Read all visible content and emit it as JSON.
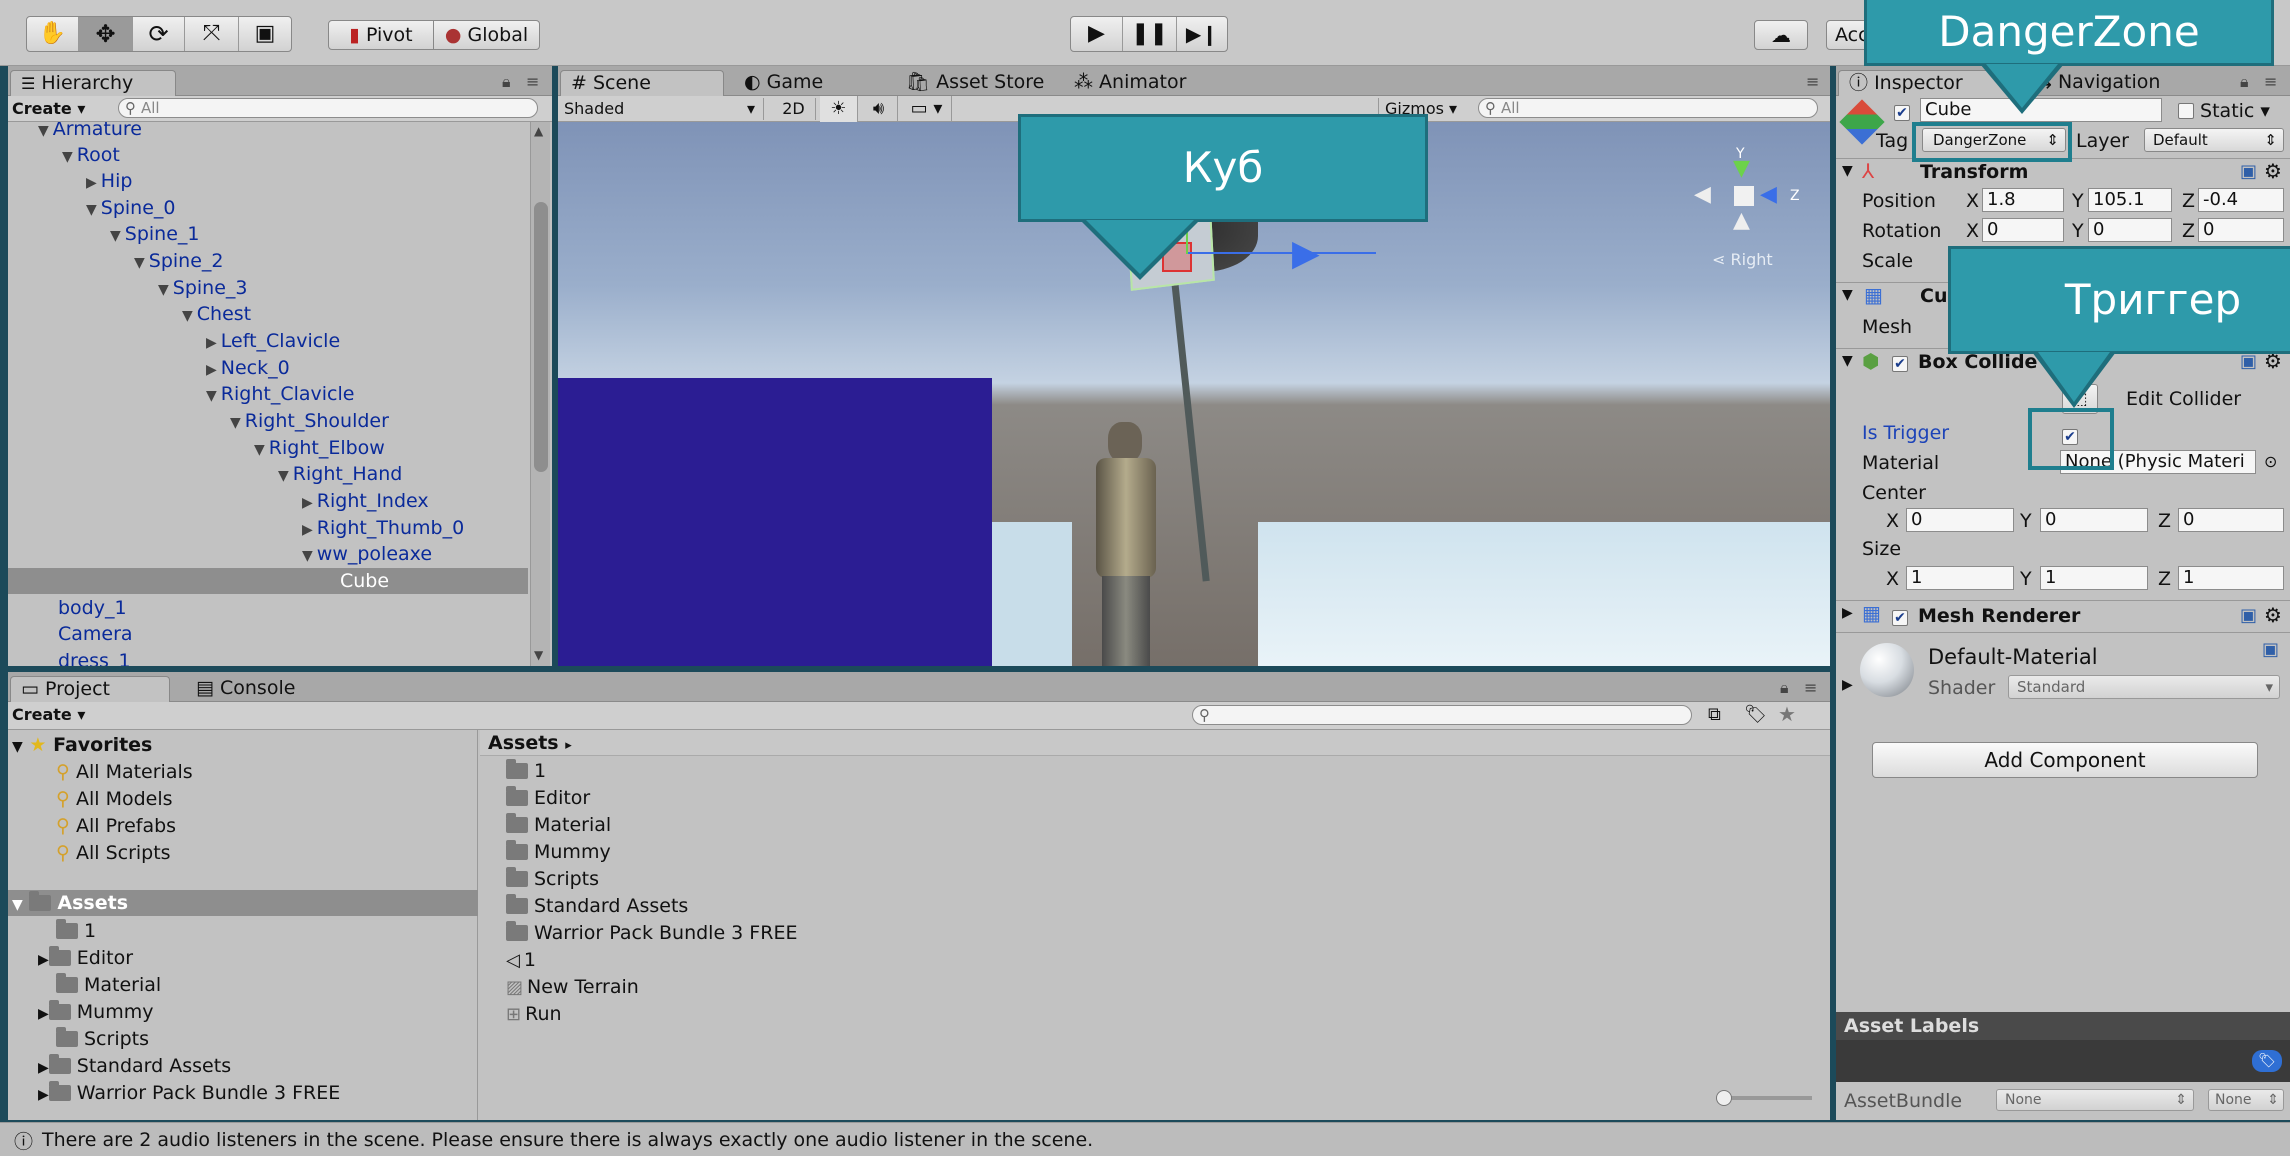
{
  "toolbar": {
    "pivot_label": "Pivot",
    "global_label": "Global",
    "account_label": "Acc"
  },
  "hierarchy": {
    "tab_label": "Hierarchy",
    "create_label": "Create",
    "search_placeholder": "All",
    "items": [
      {
        "label": "Armature"
      },
      {
        "label": "Root"
      },
      {
        "label": "Hip"
      },
      {
        "label": "Spine_0"
      },
      {
        "label": "Spine_1"
      },
      {
        "label": "Spine_2"
      },
      {
        "label": "Spine_3"
      },
      {
        "label": "Chest"
      },
      {
        "label": "Left_Clavicle"
      },
      {
        "label": "Neck_0"
      },
      {
        "label": "Right_Clavicle"
      },
      {
        "label": "Right_Shoulder"
      },
      {
        "label": "Right_Elbow"
      },
      {
        "label": "Right_Hand"
      },
      {
        "label": "Right_Index"
      },
      {
        "label": "Right_Thumb_0"
      },
      {
        "label": "ww_poleaxe"
      },
      {
        "label": "Cube"
      },
      {
        "label": "body_1"
      },
      {
        "label": "Camera"
      },
      {
        "label": "dress_1"
      }
    ]
  },
  "scene": {
    "tabs": [
      "Scene",
      "Game",
      "Asset Store",
      "Animator"
    ],
    "shading": "Shaded",
    "mode_2d": "2D",
    "gizmos_label": "Gizmos",
    "search_placeholder": "All",
    "axis_y": "Y",
    "axis_z": "Z",
    "view_label": "Right"
  },
  "inspector": {
    "tabs": [
      "Inspector",
      "Navigation"
    ],
    "object_name": "Cube",
    "static_label": "Static",
    "tag_label": "Tag",
    "tag_value": "DangerZone",
    "layer_label": "Layer",
    "layer_value": "Default",
    "transform": {
      "title": "Transform",
      "position_label": "Position",
      "rotation_label": "Rotation",
      "scale_label": "Scale",
      "position": {
        "x": "1.8",
        "y": "105.1",
        "z": "-0.4"
      },
      "rotation": {
        "x": "0",
        "y": "0",
        "z": "0"
      }
    },
    "mesh_filter": {
      "title": "Cu",
      "mesh_label": "Mesh"
    },
    "box_collider": {
      "title": "Box Collide",
      "edit_collider_label": "Edit Collider",
      "is_trigger_label": "Is Trigger",
      "material_label": "Material",
      "material_value": "None (Physic Materi",
      "center_label": "Center",
      "center": {
        "x": "0",
        "y": "0",
        "z": "0"
      },
      "size_label": "Size",
      "size": {
        "x": "1",
        "y": "1",
        "z": "1"
      }
    },
    "mesh_renderer": {
      "title": "Mesh Renderer"
    },
    "material": {
      "name": "Default-Material",
      "shader_label": "Shader",
      "shader_value": "Standard"
    },
    "add_component_label": "Add Component",
    "asset_labels_title": "Asset Labels",
    "asset_bundle_label": "AssetBundle",
    "asset_bundle_value": "None",
    "asset_bundle_variant": "None"
  },
  "project": {
    "tabs": [
      "Project",
      "Console"
    ],
    "create_label": "Create",
    "favorites_label": "Favorites",
    "favorites": [
      "All Materials",
      "All Models",
      "All Prefabs",
      "All Scripts"
    ],
    "assets_label": "Assets",
    "tree": [
      "1",
      "Editor",
      "Material",
      "Mummy",
      "Scripts",
      "Standard Assets",
      "Warrior Pack Bundle 3 FREE"
    ],
    "breadcrumb": "Assets",
    "files": [
      "1",
      "Editor",
      "Material",
      "Mummy",
      "Scripts",
      "Standard Assets",
      "Warrior Pack Bundle 3 FREE",
      "1",
      "New Terrain",
      "Run"
    ]
  },
  "status_message": "There are 2 audio listeners in the scene. Please ensure there is always exactly one audio listener in the scene.",
  "callouts": {
    "cube": "Куб",
    "danger_zone": "DangerZone",
    "trigger": "Триггер"
  }
}
